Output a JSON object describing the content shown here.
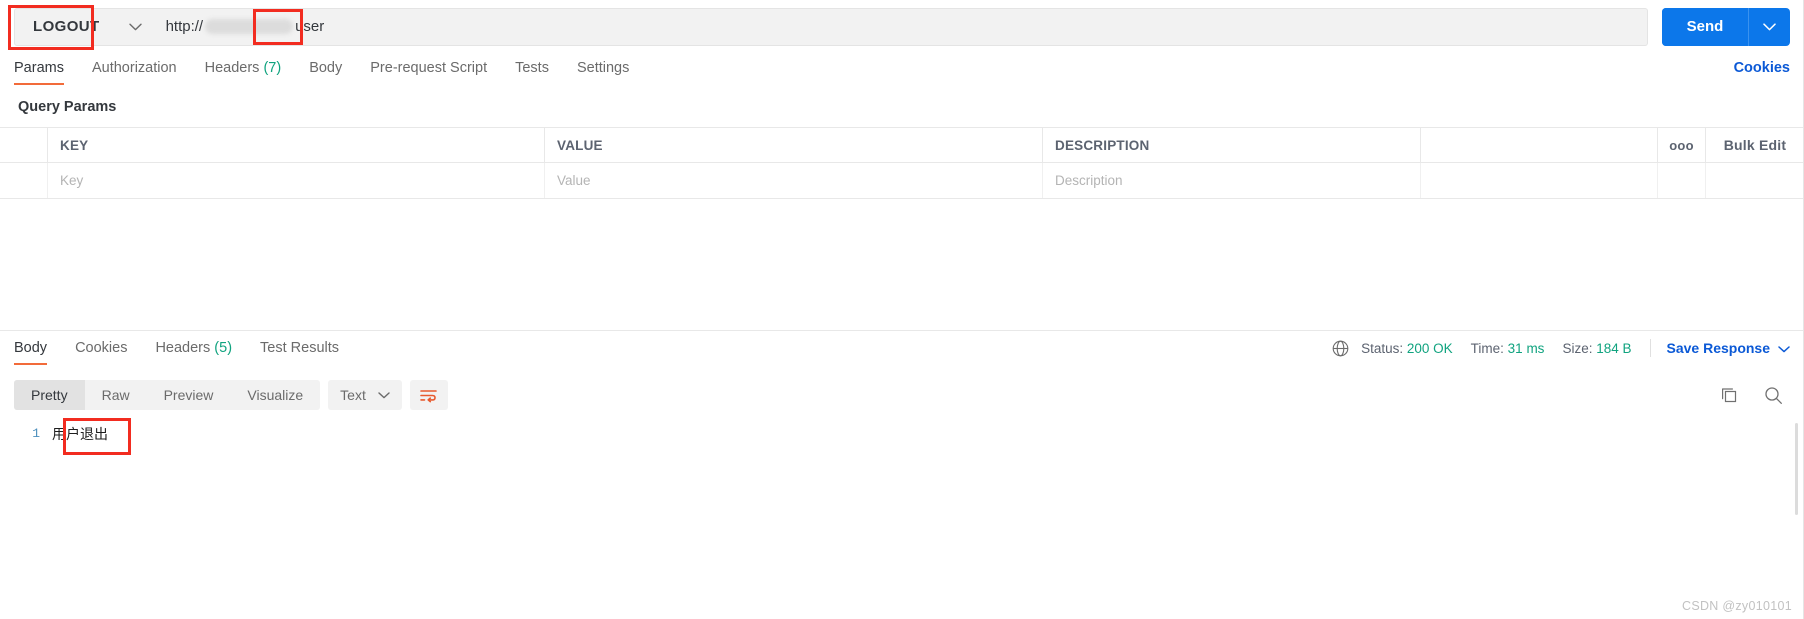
{
  "request": {
    "method": "LOGOUT",
    "url_prefix": "http://",
    "url_suffix": "user",
    "send_label": "Send",
    "method_caret_icon": "chevron-down-icon",
    "send_caret_icon": "chevron-down-icon"
  },
  "request_tabs": [
    {
      "label": "Params",
      "active": true
    },
    {
      "label": "Authorization",
      "active": false
    },
    {
      "label": "Headers",
      "count": "(7)",
      "active": false
    },
    {
      "label": "Body",
      "active": false
    },
    {
      "label": "Pre-request Script",
      "active": false
    },
    {
      "label": "Tests",
      "active": false
    },
    {
      "label": "Settings",
      "active": false
    }
  ],
  "cookies_link": "Cookies",
  "query_params": {
    "section_label": "Query Params",
    "columns": [
      "KEY",
      "VALUE",
      "DESCRIPTION"
    ],
    "placeholder_row": {
      "key": "Key",
      "value": "Value",
      "description": "Description"
    },
    "options_icon": "ooo",
    "bulk_edit_label": "Bulk Edit"
  },
  "response_tabs": [
    {
      "label": "Body",
      "active": true
    },
    {
      "label": "Cookies",
      "active": false
    },
    {
      "label": "Headers",
      "count": "(5)",
      "active": false
    },
    {
      "label": "Test Results",
      "active": false
    }
  ],
  "response_status": {
    "globe_icon": "globe-icon",
    "status_label": "Status:",
    "status_value": "200 OK",
    "time_label": "Time:",
    "time_value": "31 ms",
    "size_label": "Size:",
    "size_value": "184 B",
    "save_response_label": "Save Response",
    "save_caret_icon": "chevron-down-icon"
  },
  "format_bar": {
    "segments": [
      {
        "label": "Pretty",
        "active": true
      },
      {
        "label": "Raw",
        "active": false
      },
      {
        "label": "Preview",
        "active": false
      },
      {
        "label": "Visualize",
        "active": false
      }
    ],
    "language": "Text",
    "language_caret_icon": "chevron-down-icon",
    "wrap_icon": "word-wrap-icon",
    "copy_icon": "copy-icon",
    "search_icon": "search-icon"
  },
  "response_body": {
    "line_number": "1",
    "content": "用户退出"
  },
  "watermark": "CSDN @zy010101",
  "colors": {
    "accent_orange": "#f26b3a",
    "send_blue": "#0c77ea",
    "link_blue": "#0b59d6",
    "status_green": "#10a37f",
    "annotation_red": "#f22c20"
  }
}
